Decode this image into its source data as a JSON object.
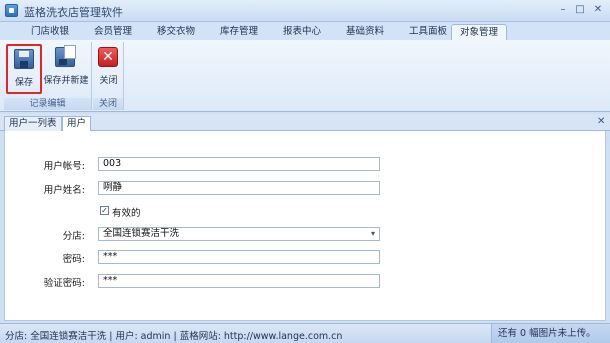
{
  "window": {
    "title": "蓝格洗衣店管理软件",
    "min": "–",
    "max": "□",
    "close": "✕"
  },
  "ribbon": {
    "tabs": [
      "门店收银",
      "会员管理",
      "移交衣物",
      "库存管理",
      "报表中心",
      "基础资料",
      "工具面板",
      "对象管理"
    ],
    "active_tab": "对象管理",
    "groups": [
      {
        "label": "记录编辑",
        "buttons": [
          {
            "label": "保存",
            "icon": "save-icon"
          },
          {
            "label": "保存并新建",
            "icon": "save-new-icon"
          }
        ]
      },
      {
        "label": "关闭",
        "buttons": [
          {
            "label": "关闭",
            "icon": "close-red-icon"
          }
        ]
      }
    ]
  },
  "doc_tabs": [
    "用户一列表",
    "用户"
  ],
  "form": {
    "account_label": "用户帐号:",
    "account_value": "003",
    "name_label": "用户姓名:",
    "name_value": "咧静",
    "valid_label": "有效的",
    "valid_checked": "✓",
    "store_label": "分店:",
    "store_value": "全国连锁赛洁干洗",
    "password_label": "密码:",
    "password_value": "***",
    "confirm_label": "验证密码:",
    "confirm_value": "***"
  },
  "status": {
    "left": "分店: 全国连锁赛洁干洗 | 用户: admin | 蓝格网站: http://www.lange.com.cn",
    "right": "还有 0 幅图片未上传。"
  },
  "colors": {
    "accent_red": "#e0262b",
    "ribbon_blue": "#dde9f8"
  }
}
